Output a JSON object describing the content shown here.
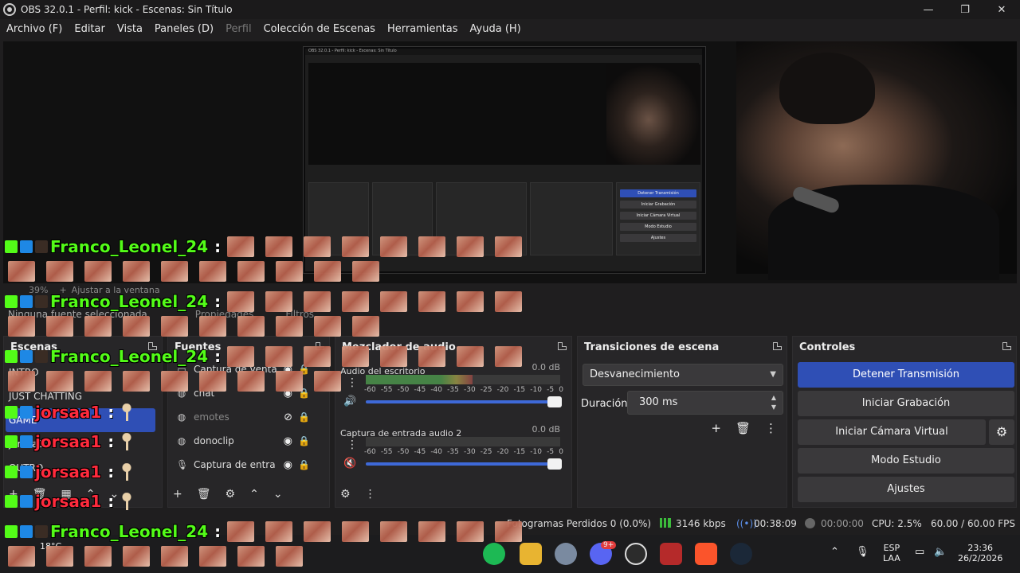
{
  "window": {
    "title": "OBS 32.0.1 - Perfil: kick - Escenas: Sin Título"
  },
  "menu": [
    "Archivo (F)",
    "Editar",
    "Vista",
    "Paneles (D)",
    "Perfil",
    "Colección de Escenas",
    "Herramientas",
    "Ayuda (H)"
  ],
  "preview": {
    "zoom": "39%",
    "fit_label": "Ajustar a la ventana",
    "no_source": "Ninguna fuente seleccionada",
    "properties": "Propiedades",
    "filters": "Filtros"
  },
  "scenes": {
    "title": "Escenas",
    "items": [
      "INTRO",
      "JUST CHATTING",
      "GAME",
      "jorsaa1",
      "OUTRO"
    ]
  },
  "sources": {
    "title": "Fuentes",
    "items": [
      {
        "icon": "monitor-icon",
        "name": "Captura de venta"
      },
      {
        "icon": "globe-icon",
        "name": "chat"
      },
      {
        "icon": "globe-icon",
        "name": "emotes"
      },
      {
        "icon": "globe-icon",
        "name": "donoclip"
      },
      {
        "icon": "mic-icon",
        "name": "Captura de entra"
      }
    ]
  },
  "mixer": {
    "title": "Mezclador de audio",
    "channels": [
      {
        "name": "Audio del escritorio",
        "db": "0.0 dB",
        "level": 0.55
      },
      {
        "name": "Captura de entrada audio 2",
        "db": "0.0 dB",
        "level": 0.0
      }
    ],
    "scale": [
      "-60",
      "-55",
      "-50",
      "-45",
      "-40",
      "-35",
      "-30",
      "-25",
      "-20",
      "-15",
      "-10",
      "-5",
      "0"
    ]
  },
  "transitions": {
    "title": "Transiciones de escena",
    "type": "Desvanecimiento",
    "duration_label": "Duración",
    "duration": "300 ms"
  },
  "controls": {
    "title": "Controles",
    "stop_stream": "Detener Transmisión",
    "start_rec": "Iniciar Grabación",
    "virtual_cam": "Iniciar Cámara Virtual",
    "studio": "Modo Estudio",
    "settings": "Ajustes"
  },
  "status": {
    "dropped": "Fotogramas Perdidos 0 (0.0%)",
    "bitrate": "3146 kbps",
    "stream_time": "00:38:09",
    "rec_time": "00:00:00",
    "cpu": "CPU: 2.5%",
    "fps": "60.00 / 60.00 FPS"
  },
  "taskbar": {
    "weather": "18°C",
    "lang": "ESP",
    "layout": "LAA",
    "time": "23:36",
    "date": "26/2/2026",
    "discord_badge": "9+"
  },
  "chat": {
    "user1": "Franco_Leonel_24",
    "user2": "jorsaa1",
    "colon": ":"
  },
  "colors": {
    "accent": "#2f4fb5",
    "kick_green": "#53fc18",
    "chat_red": "#ff2a3c"
  }
}
